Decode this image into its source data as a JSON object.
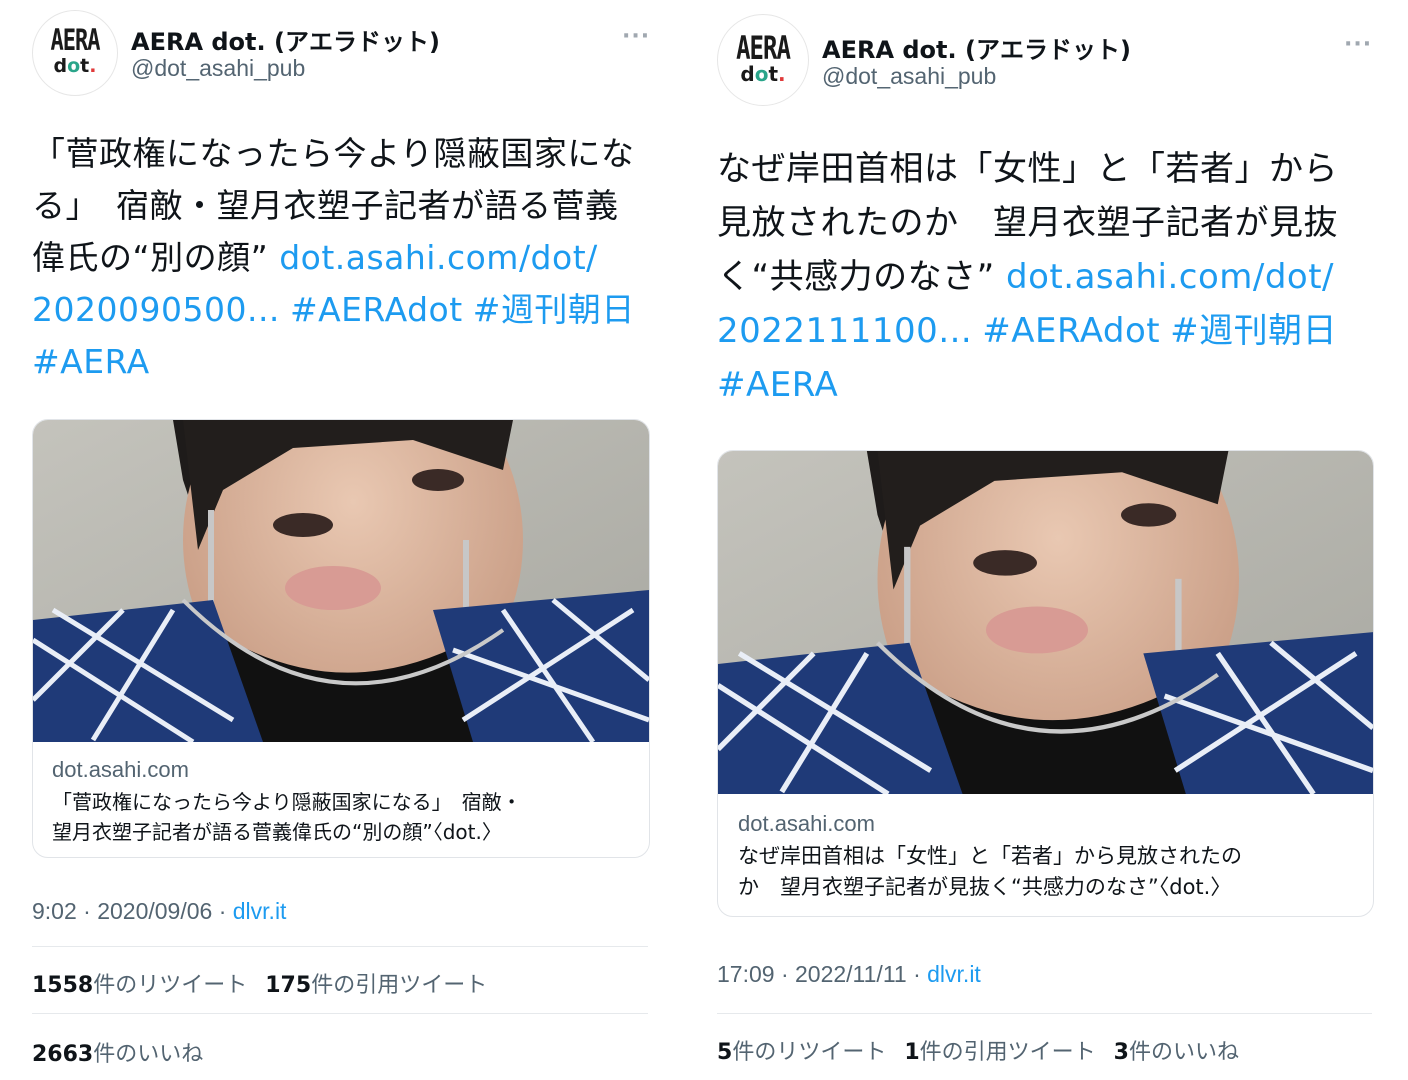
{
  "tweets": [
    {
      "account": {
        "name": "AERA dot. (アエラドット)",
        "handle": "@dot_asahi_pub",
        "logo_top": "AERA",
        "logo_bottom": "dot."
      },
      "text_lines": [
        "「菅政権になったら今より隠蔽国家にな",
        "る」　宿敵・望月衣塑子記者が語る菅義"
      ],
      "text_line3_plain": "偉氏の“別の顔” ",
      "text_line3_link": "dot.asahi.com/dot/",
      "text_line4_link": "2020090500...",
      "hashtag_1": "#AERAdot",
      "hashtag_2": "#週刊朝日",
      "hashtag_3": "#AERA",
      "card": {
        "domain": "dot.asahi.com",
        "title_lines": [
          "「菅政権になったら今より隠蔽国家になる」　宿敵・",
          "望月衣塑子記者が語る菅義偉氏の“別の顔”〈dot.〉"
        ]
      },
      "time": "9:02 · 2020/09/06 · ",
      "source": "dlvr.it",
      "retweets_count": "1558",
      "retweets_label": "件のリツイート",
      "quotes_count": "175",
      "quotes_label": "件の引用ツイート",
      "likes_count": "2663",
      "likes_label": "件のいいね",
      "more_label": "···"
    },
    {
      "account": {
        "name": "AERA dot. (アエラドット)",
        "handle": "@dot_asahi_pub",
        "logo_top": "AERA",
        "logo_bottom": "dot."
      },
      "text_lines": [
        "なぜ岸田首相は「女性」と「若者」から",
        "見放されたのか　望月衣塑子記者が見抜"
      ],
      "text_line3_plain": "く“共感力のなさ” ",
      "text_line3_link": "dot.asahi.com/dot/",
      "text_line4_link": "2022111100...",
      "hashtag_1": "#AERAdot",
      "hashtag_2": "#週刊朝日",
      "hashtag_3": "#AERA",
      "card": {
        "domain": "dot.asahi.com",
        "title_lines": [
          "なぜ岸田首相は「女性」と「若者」から見放されたの",
          "か　望月衣塑子記者が見抜く“共感力のなさ”〈dot.〉"
        ]
      },
      "time": "17:09 · 2022/11/11 · ",
      "source": "dlvr.it",
      "retweets_count": "5",
      "retweets_label": "件のリツイート",
      "quotes_count": "1",
      "quotes_label": "件の引用ツイート",
      "likes_count": "3",
      "likes_label": "件のいいね",
      "more_label": "···"
    }
  ]
}
